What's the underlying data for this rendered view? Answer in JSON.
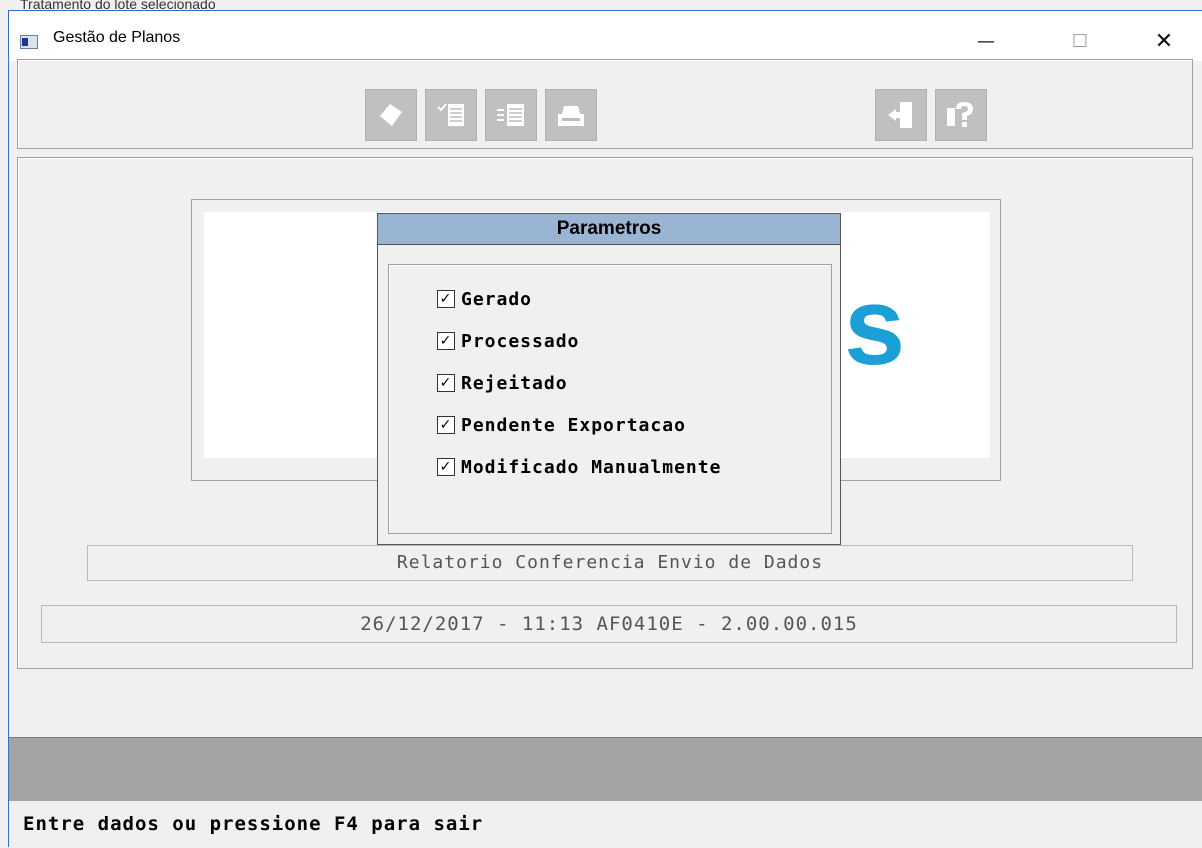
{
  "background_text": "Tratamento do lote selecionado",
  "window": {
    "title": "Gestão de Planos",
    "minimize_glyph": "—",
    "maximize_glyph": "☐",
    "close_glyph": "✕"
  },
  "toolbar": {
    "buttons": [
      {
        "name": "eraser-icon"
      },
      {
        "name": "checklist-icon"
      },
      {
        "name": "list-arrow-icon"
      },
      {
        "name": "printer-icon"
      },
      {
        "name": "exit-door-icon"
      },
      {
        "name": "help-question-icon"
      }
    ]
  },
  "logo": {
    "visible_glyph": "s",
    "color": "#1a9fd6"
  },
  "dialog": {
    "title": "Parametros",
    "title_bg": "#9ab4d3",
    "options": [
      {
        "label": "Gerado",
        "checked": true
      },
      {
        "label": "Processado",
        "checked": true
      },
      {
        "label": "Rejeitado",
        "checked": true
      },
      {
        "label": "Pendente Exportacao",
        "checked": true
      },
      {
        "label": "Modificado Manualmente",
        "checked": true
      }
    ],
    "check_glyph": "✓"
  },
  "report": {
    "title": "Relatorio Conferencia Envio de Dados"
  },
  "version": {
    "text": "26/12/2017 - 11:13  AF0410E - 2.00.00.015"
  },
  "status": {
    "message": "Entre dados ou pressione F4 para sair"
  }
}
